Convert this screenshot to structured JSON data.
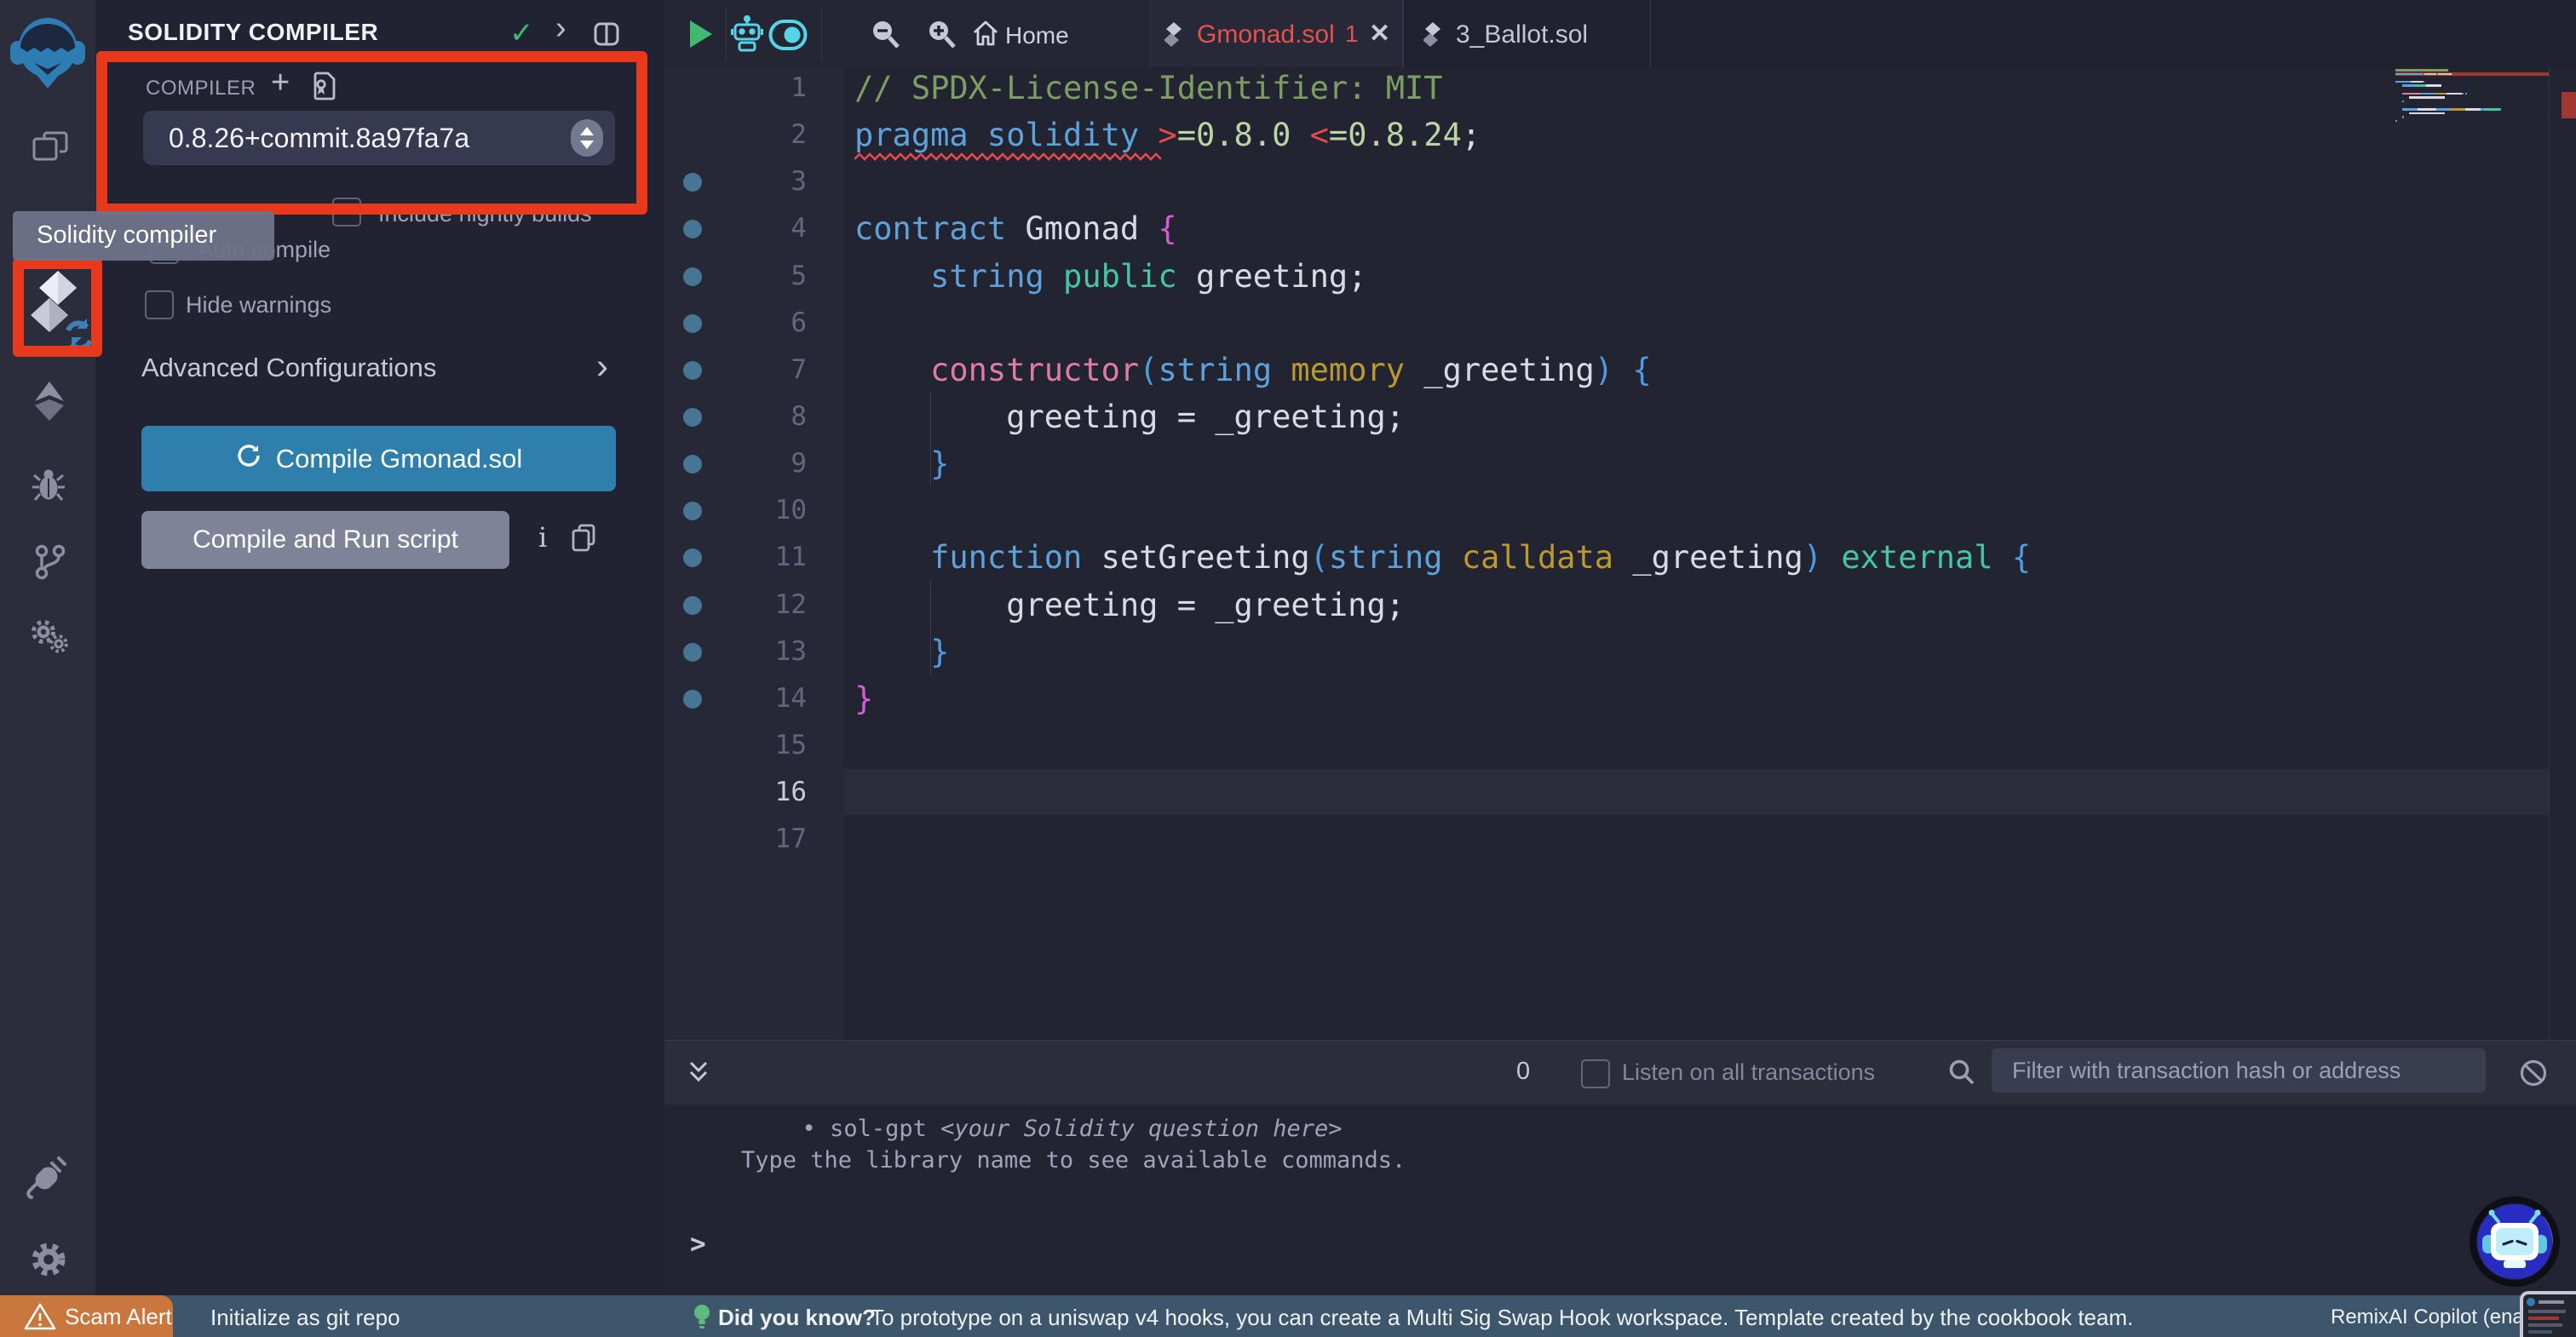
{
  "colors": {
    "annotation_red": "#e8391d",
    "compile_blue": "#2e7fab",
    "accent_cyan": "#55d5e8",
    "play_green": "#43b873",
    "check_green": "#3cbb72",
    "tab_error_red": "#e5524e",
    "status_blue": "#3d566b",
    "scam_orange": "#c9773c",
    "fab_blue": "#282cc0"
  },
  "panel": {
    "title": "SOLIDITY COMPILER",
    "section_label": "COMPILER",
    "version": "0.8.26+commit.8a97fa7a",
    "nightly_label": "Include nightly builds",
    "autocompile_label": "Auto compile",
    "hidewarn_label": "Hide warnings",
    "advanced_label": "Advanced Configurations",
    "compile_label": "Compile Gmonad.sol",
    "run_label": "Compile and Run script",
    "info_label": "i",
    "tooltip": "Solidity compiler"
  },
  "topbar": {
    "home_label": "Home",
    "tabs": [
      {
        "label": "Gmonad.sol",
        "badge": "1",
        "close": "✕"
      },
      {
        "label": "3_Ballot.sol"
      }
    ]
  },
  "editor": {
    "active_line": 16,
    "token_colors": {
      "com": "#7d9e63",
      "kw": "#5ea2dc",
      "red": "#e5484d",
      "num": "#bcd3a2",
      "id": "#d8dae4",
      "pink": "#e07ba2",
      "gold": "#bb992e",
      "teal": "#45c6a0",
      "mag": "#d45fd4",
      "blu": "#4f9be0"
    },
    "lines": [
      {
        "tokens": [
          [
            "// SPDX-License-Identifier: MIT",
            "com"
          ]
        ]
      },
      {
        "error": true,
        "tokens": [
          [
            "pragma solidity ",
            "kw"
          ],
          [
            ">",
            "red"
          ],
          [
            "=0.8.0 ",
            "num"
          ],
          [
            "<",
            "red"
          ],
          [
            "=0.8.24",
            "num"
          ],
          [
            ";",
            "id"
          ]
        ]
      },
      {
        "dot": true
      },
      {
        "dot": true,
        "tokens": [
          [
            "contract ",
            "kw"
          ],
          [
            "Gmonad ",
            "id"
          ],
          [
            "{",
            "mag"
          ]
        ]
      },
      {
        "dot": true,
        "tokens": [
          [
            "    ",
            "id"
          ],
          [
            "string ",
            "kw"
          ],
          [
            "public ",
            "teal"
          ],
          [
            "greeting;",
            "id"
          ]
        ]
      },
      {
        "dot": true
      },
      {
        "dot": true,
        "tokens": [
          [
            "    ",
            "id"
          ],
          [
            "constructor",
            "pink"
          ],
          [
            "(",
            "blu"
          ],
          [
            "string ",
            "kw"
          ],
          [
            "memory ",
            "gold"
          ],
          [
            "_greeting",
            "id"
          ],
          [
            ")",
            "blu"
          ],
          [
            " {",
            "blu"
          ]
        ]
      },
      {
        "dot": true,
        "tokens": [
          [
            "        greeting = _greeting;",
            "id"
          ]
        ]
      },
      {
        "dot": true,
        "tokens": [
          [
            "    ",
            "id"
          ],
          [
            "}",
            "blu"
          ]
        ]
      },
      {
        "dot": true
      },
      {
        "dot": true,
        "tokens": [
          [
            "    ",
            "id"
          ],
          [
            "function ",
            "kw"
          ],
          [
            "setGreeting",
            "id"
          ],
          [
            "(",
            "blu"
          ],
          [
            "string ",
            "kw"
          ],
          [
            "calldata ",
            "gold"
          ],
          [
            "_greeting",
            "id"
          ],
          [
            ") ",
            "blu"
          ],
          [
            "external ",
            "teal"
          ],
          [
            "{",
            "blu"
          ]
        ]
      },
      {
        "dot": true,
        "tokens": [
          [
            "        greeting = _greeting;",
            "id"
          ]
        ]
      },
      {
        "dot": true,
        "tokens": [
          [
            "    ",
            "id"
          ],
          [
            "}",
            "blu"
          ]
        ]
      },
      {
        "dot": true,
        "tokens": [
          [
            "}",
            "mag"
          ]
        ]
      },
      {},
      {},
      {}
    ]
  },
  "terminal": {
    "count": "0",
    "listen_label": "Listen on all transactions",
    "filter_placeholder": "Filter with transaction hash or address",
    "bullet": "•",
    "line1_cmd": "sol-gpt ",
    "line1_arg": "<your Solidity question here>",
    "line2": "Type the library name to see available commands.",
    "prompt": ">"
  },
  "statusbar": {
    "scam_label": "Scam Alert",
    "git_label": "Initialize as git repo",
    "know_label": "Did you know?",
    "tip_text": "To prototype on a uniswap v4 hooks, you can create a Multi Sig Swap Hook workspace. Template created by the cookbook team.",
    "copilot_label": "RemixAI Copilot (enabled)"
  }
}
